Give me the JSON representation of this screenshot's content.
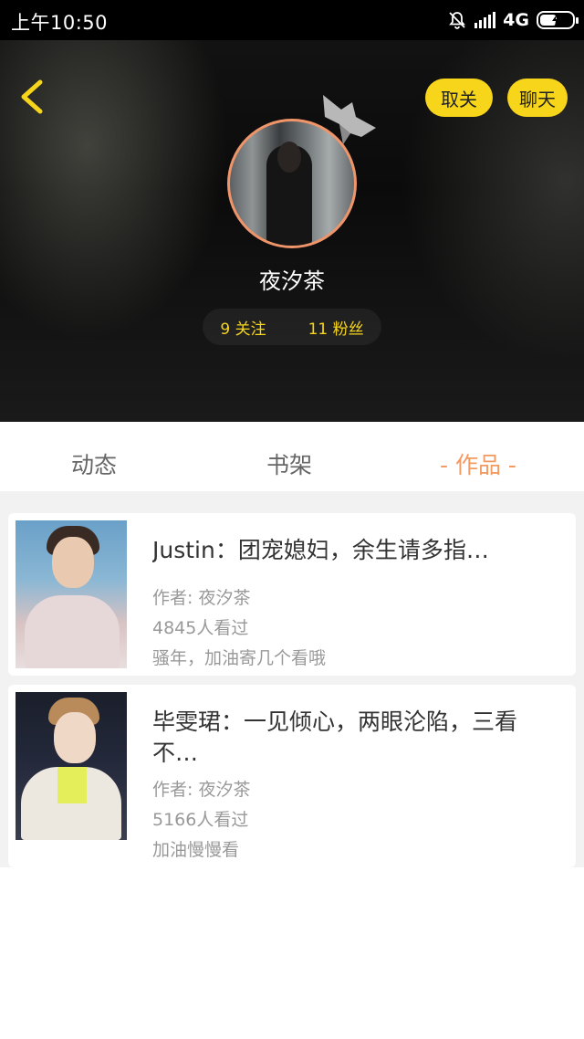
{
  "status_bar": {
    "time": "上午10:50",
    "network": "4G",
    "icons": [
      "mute-bell-icon",
      "hd-signal-icon",
      "battery-charging-icon"
    ]
  },
  "header": {
    "back_icon": "chevron-left-icon",
    "unfollow_label": "取关",
    "chat_label": "聊天",
    "accent_color": "#f7d51b",
    "avatar_border_color": "#f0956a"
  },
  "profile": {
    "name": "夜汐茶",
    "following": "9 关注",
    "followers": "11 粉丝"
  },
  "tabs": [
    {
      "label": "动态"
    },
    {
      "label": "书架"
    },
    {
      "label": "- 作品 -",
      "active": true
    }
  ],
  "works": [
    {
      "title": "Justin：团宠媳妇，余生请多指…",
      "author": "作者: 夜汐茶",
      "views": "4845人看过",
      "desc": "骚年，加油寄几个看哦"
    },
    {
      "title": "毕雯珺：一见倾心，两眼沦陷，三看不…",
      "author": "作者: 夜汐茶",
      "views": "5166人看过",
      "desc": "加油慢慢看"
    }
  ]
}
